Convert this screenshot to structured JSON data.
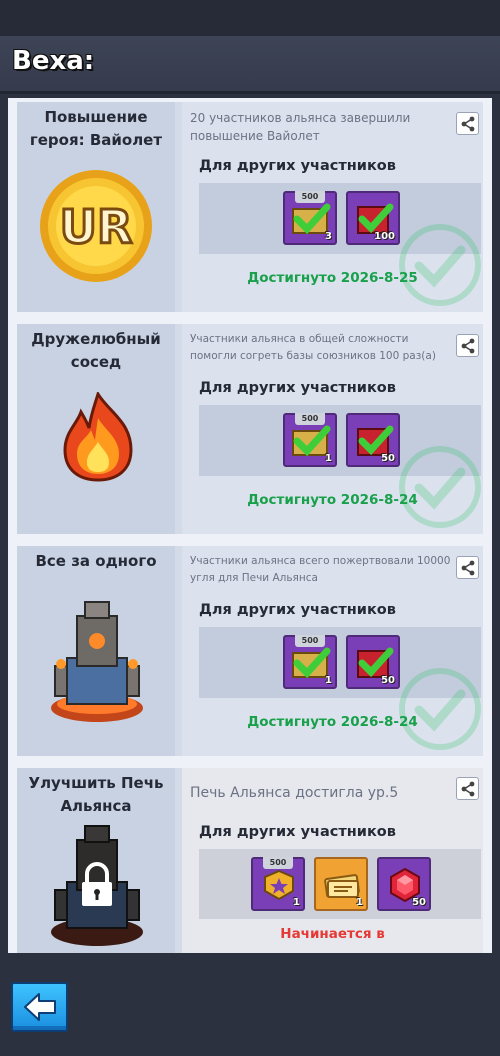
{
  "header": {
    "title": "Веха:"
  },
  "cards": [
    {
      "title": "Повышение героя: Вайолет",
      "description": "20 участников альянса завершили повышение Вайолет",
      "for_others": "Для других участников",
      "rewards": [
        {
          "icon": "check-chest-icon",
          "cap": "500",
          "count": "3"
        },
        {
          "icon": "red-box-icon",
          "count": "100"
        }
      ],
      "status": "Достигнуто 2026-8-25",
      "image": "ur-badge-icon"
    },
    {
      "title": "Дружелюбный сосед",
      "description": "Участники альянса в общей сложности помогли согреть базы союзников 100 раз(а)",
      "for_others": "Для других участников",
      "rewards": [
        {
          "icon": "check-chest-icon",
          "cap": "500",
          "count": "1"
        },
        {
          "icon": "red-box-icon",
          "count": "50"
        }
      ],
      "status": "Достигнуто 2026-8-24",
      "image": "flame-icon"
    },
    {
      "title": "Все за одного",
      "description": "Участники альянса всего пожертвовали 10000 угля для Печи Альянса",
      "for_others": "Для других участников",
      "rewards": [
        {
          "icon": "check-chest-icon",
          "cap": "500",
          "count": "1"
        },
        {
          "icon": "red-box-icon",
          "count": "50"
        }
      ],
      "status": "Достигнуто 2026-8-24",
      "image": "furnace-icon"
    },
    {
      "title": "Улучшить Печь Альянса",
      "description": "Печь Альянса достигла ур.5",
      "for_others": "Для других участников",
      "rewards": [
        {
          "icon": "badge-chest-icon",
          "cap": "500",
          "count": "1"
        },
        {
          "icon": "gold-ticket-icon",
          "count": "1"
        },
        {
          "icon": "red-gem-icon",
          "count": "50"
        }
      ],
      "status": "Начинается в",
      "image": "locked-furnace-icon"
    }
  ],
  "colors": {
    "achieved": "#18a04a",
    "starts": "#e53935",
    "accent_blue": "#1a8fe0"
  },
  "footer": {
    "back_icon": "back-arrow-icon"
  }
}
